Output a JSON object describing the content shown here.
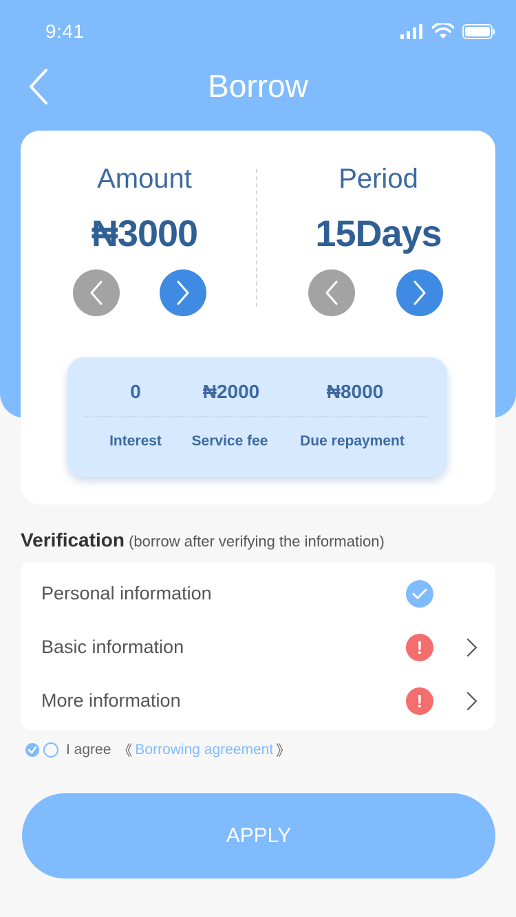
{
  "status_bar": {
    "time": "9:41"
  },
  "nav": {
    "title": "Borrow"
  },
  "loan": {
    "amount_label": "Amount",
    "amount_value": "₦3000",
    "period_label": "Period",
    "period_value": "15Days"
  },
  "summary": {
    "interest_value": "0",
    "interest_label": "Interest",
    "service_fee_value": "₦2000",
    "service_fee_label": "Service fee",
    "due_value": "₦8000",
    "due_label": "Due repayment"
  },
  "verification": {
    "title": "Verification",
    "subtitle": "(borrow after verifying the information)",
    "items": [
      {
        "label": "Personal information",
        "status": "verified"
      },
      {
        "label": "Basic information",
        "status": "warning",
        "status_symbol": "!"
      },
      {
        "label": "More information",
        "status": "warning",
        "status_symbol": "!"
      }
    ]
  },
  "agreement": {
    "prefix": "I agree",
    "open_bracket": "《",
    "link": "Borrowing agreement",
    "close_bracket": "》"
  },
  "apply_button": {
    "label": "APPLY"
  },
  "colors": {
    "primary_light": "#80bbfd",
    "primary_dark": "#3f8ae2",
    "text_blue": "#3d6aa0",
    "warning_red": "#f46e6e",
    "disabled_grey": "#a3a3a3"
  }
}
